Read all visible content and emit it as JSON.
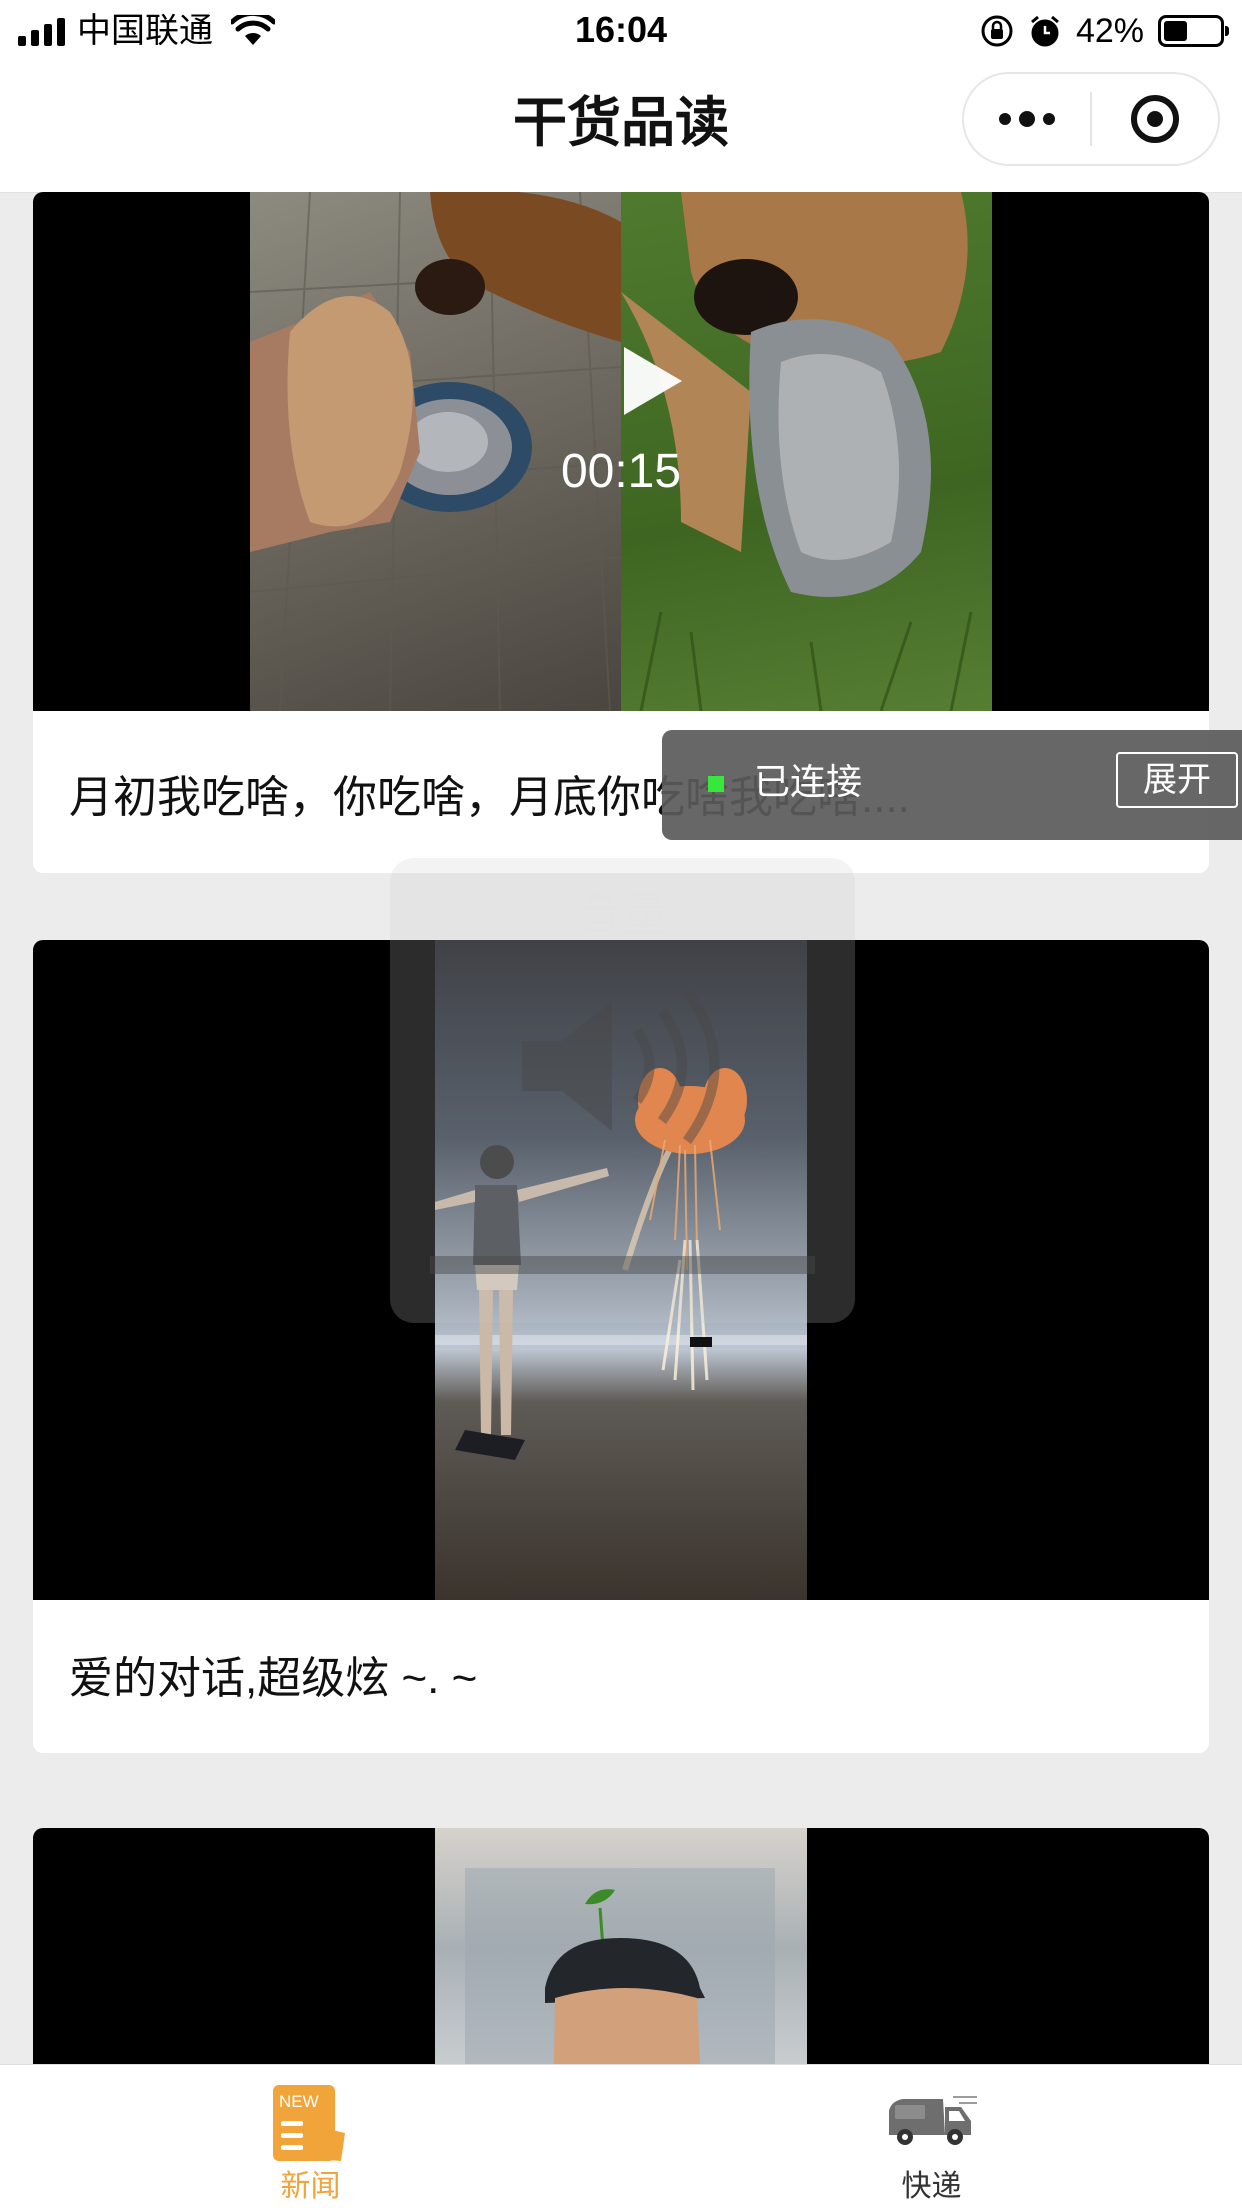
{
  "status_bar": {
    "carrier": "中国联通",
    "time": "16:04",
    "battery": "42%",
    "battery_level": 0.42
  },
  "nav": {
    "title": "干货品读"
  },
  "feed": {
    "items": [
      {
        "caption": "月初我吃啥，你吃啥，月底你吃啥我吃啥....",
        "duration": "00:15"
      },
      {
        "caption": "爱的对话,超级炫 ~. ~"
      },
      {
        "caption": ""
      }
    ]
  },
  "overlay": {
    "connection_text": "已连接",
    "expand_label": "展开",
    "volume_title": "音量"
  },
  "tabs": [
    {
      "label": "新闻",
      "badge": "NEW",
      "icon": "news-icon",
      "active": true,
      "color": "#f0a43a"
    },
    {
      "label": "快递",
      "icon": "delivery-truck-icon",
      "active": false,
      "color": "#333333"
    }
  ],
  "colors": {
    "accent": "#f0a43a",
    "background": "#ececec",
    "connected": "#39e63b"
  }
}
